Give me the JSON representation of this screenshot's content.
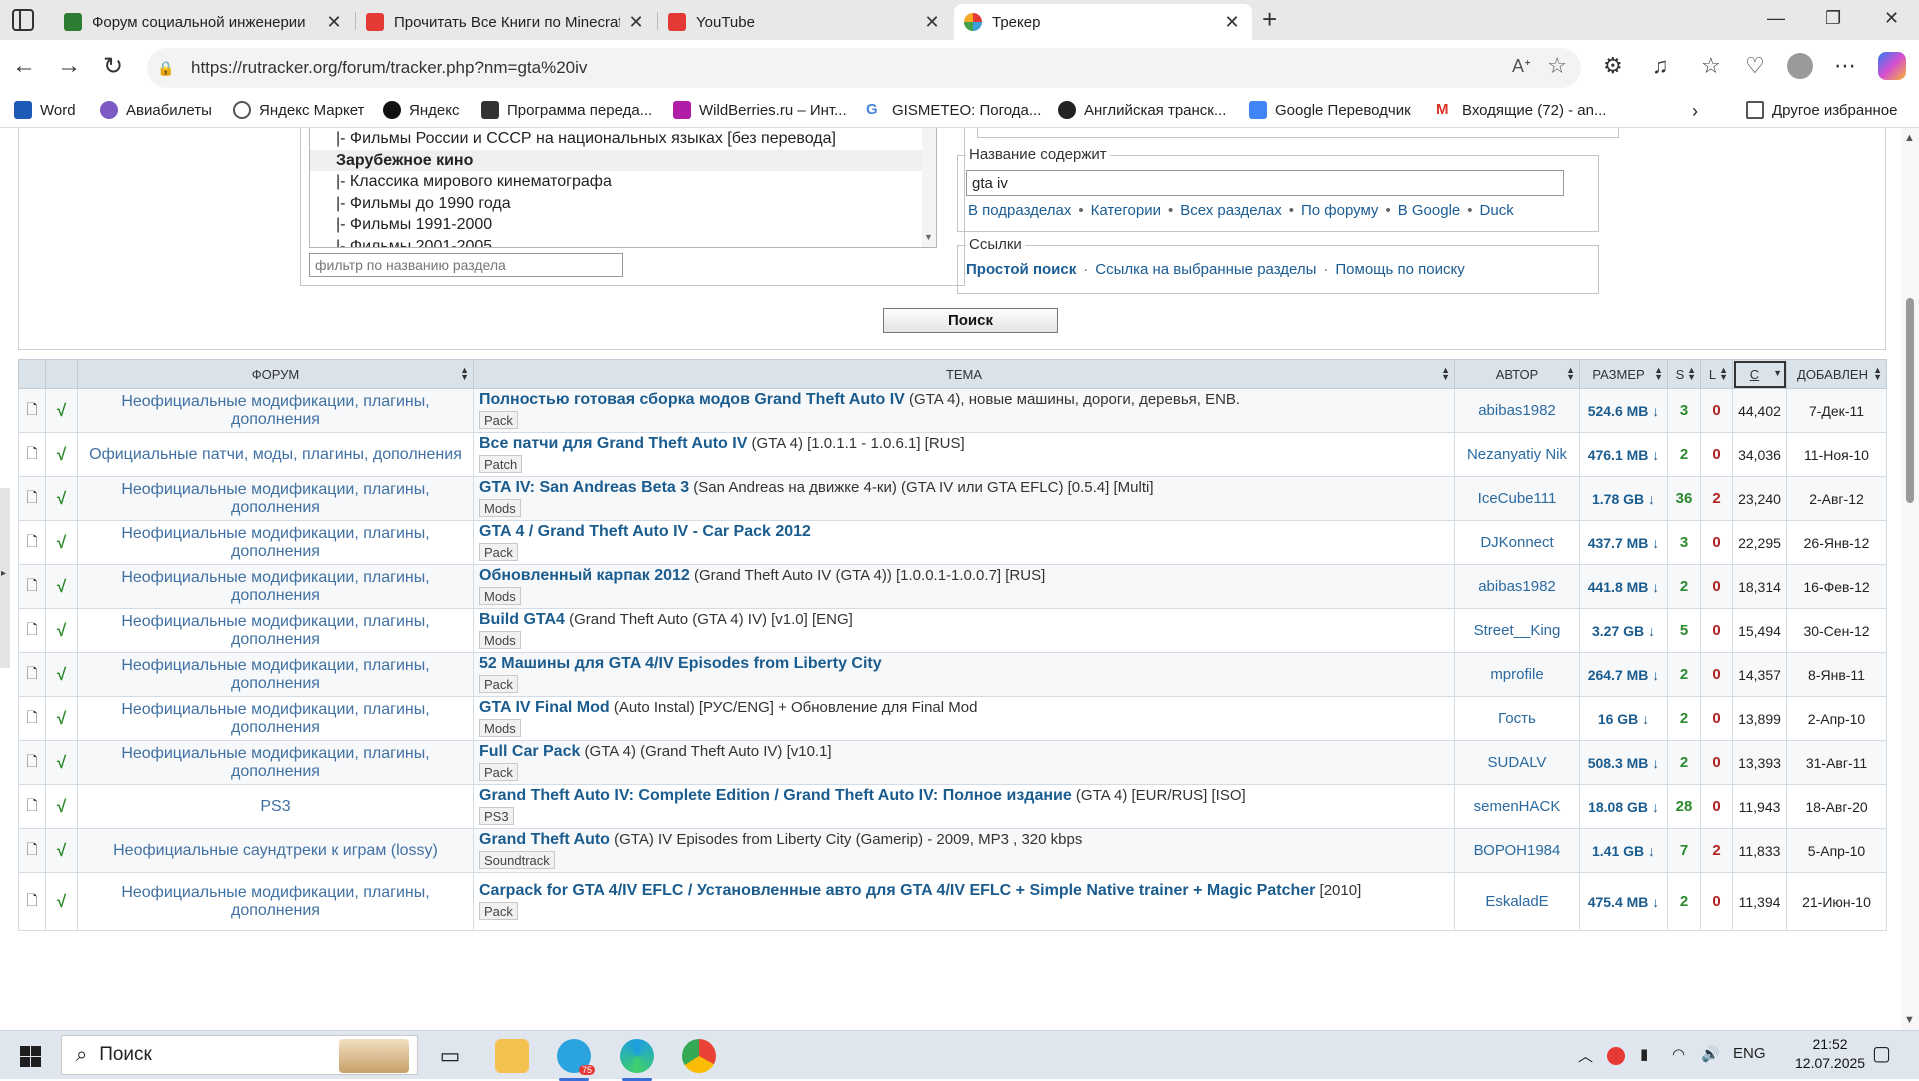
{
  "browser": {
    "tabs": [
      {
        "title": "Форум социальной инженерии",
        "favicon_color": "#2e7d32"
      },
      {
        "title": "Прочитать Все Книги по Minecraft",
        "favicon_color": "#e53935"
      },
      {
        "title": "YouTube",
        "favicon_color": "#e53935"
      },
      {
        "title": "Трекер",
        "favicon_color": "#3aa0d8"
      }
    ],
    "url": "https://rutracker.org/forum/tracker.php?nm=gta%20iv",
    "favorites": [
      {
        "label": "Word",
        "color": "#1e5bb8"
      },
      {
        "label": "Авиабилеты",
        "color": "#7c5cc4"
      },
      {
        "label": "Яндекс Маркет",
        "color": "#555555"
      },
      {
        "label": "Яндекс",
        "color": "#111111"
      },
      {
        "label": "Программа переда...",
        "color": "#333333"
      },
      {
        "label": "WildBerries.ru – Инт...",
        "color": "#b01ea8"
      },
      {
        "label": "GISMETEO: Погода...",
        "color": "#4a86d8"
      },
      {
        "label": "Английская транск...",
        "color": "#222222"
      },
      {
        "label": "Google Переводчик",
        "color": "#4285f4"
      },
      {
        "label": "Входящие (72) - an...",
        "color": "#d93025"
      },
      {
        "label": "Другое избранное",
        "color": "#555555"
      }
    ]
  },
  "search": {
    "forum_options": [
      {
        "label": "|- Фильмы России и СССР на национальных языках [без перевода]",
        "group": false
      },
      {
        "label": "Зарубежное кино",
        "group": true
      },
      {
        "label": "|- Классика мирового кинематографа",
        "group": false
      },
      {
        "label": "|- Фильмы до 1990 года",
        "group": false
      },
      {
        "label": "|- Фильмы 1991-2000",
        "group": false
      },
      {
        "label": "|- Фильмы 2001-2005",
        "group": false
      }
    ],
    "filter_placeholder": "фильтр по названию раздела",
    "name_legend": "Название содержит",
    "name_value": "gta iv",
    "name_links": [
      "В подразделах",
      "Категории",
      "Всех разделах",
      "По форуму",
      "В Google",
      "Duck"
    ],
    "links_legend": "Ссылки",
    "links": [
      "Простой поиск",
      "Ссылка на выбранные разделы",
      "Помощь по поиску"
    ],
    "submit_label": "Поиск"
  },
  "table": {
    "headers": {
      "forum": "ФОРУМ",
      "topic": "ТЕМА",
      "author": "АВТОР",
      "size": "РАЗМЕР",
      "seeds": "S",
      "leech": "L",
      "downloads": "C",
      "added": "ДОБАВЛЕН"
    },
    "rows": [
      {
        "forum": "Неофициальные модификации, плагины, дополнения",
        "title_bold": "Полностью готовая сборка модов Grand Theft Auto IV",
        "title_rest": " (GTA 4), новые машины, дороги, деревья, ENB.",
        "tag": "Pack",
        "author": "abibas1982",
        "size": "524.6 MB ↓",
        "seeds": "3",
        "leech": "0",
        "downloads": "44,402",
        "added": "7-Дек-11"
      },
      {
        "forum": "Официальные патчи, моды, плагины, дополнения",
        "title_bold": "Все патчи для Grand Theft Auto IV",
        "title_rest": " (GTA 4) [1.0.1.1 - 1.0.6.1] [RUS]",
        "tag": "Patch",
        "author": "Nezanyatiy Nik",
        "size": "476.1 MB ↓",
        "seeds": "2",
        "leech": "0",
        "downloads": "34,036",
        "added": "11-Ноя-10"
      },
      {
        "forum": "Неофициальные модификации, плагины, дополнения",
        "title_bold": "GTA IV: San Andreas Beta 3",
        "title_rest": " (San Andreas на движке 4-ки) (GTA IV или GTA EFLC) [0.5.4] [Multi]",
        "tag": "Mods",
        "author": "IceCube111",
        "size": "1.78 GB ↓",
        "seeds": "36",
        "leech": "2",
        "downloads": "23,240",
        "added": "2-Авг-12"
      },
      {
        "forum": "Неофициальные модификации, плагины, дополнения",
        "title_bold": "GTA 4 / Grand Theft Auto IV - Car Pack 2012",
        "title_rest": "",
        "tag": "Pack",
        "author": "DJKonnect",
        "size": "437.7 MB ↓",
        "seeds": "3",
        "leech": "0",
        "downloads": "22,295",
        "added": "26-Янв-12"
      },
      {
        "forum": "Неофициальные модификации, плагины, дополнения",
        "title_bold": "Обновленный карпак 2012",
        "title_rest": " (Grand Theft Auto IV (GTA 4)) [1.0.0.1-1.0.0.7] [RUS]",
        "tag": "Mods",
        "author": "abibas1982",
        "size": "441.8 MB ↓",
        "seeds": "2",
        "leech": "0",
        "downloads": "18,314",
        "added": "16-Фев-12"
      },
      {
        "forum": "Неофициальные модификации, плагины, дополнения",
        "title_bold": "Build GTA4",
        "title_rest": " (Grand Theft Auto (GTA 4) IV) [v1.0] [ENG]",
        "tag": "Mods",
        "author": "Street__King",
        "size": "3.27 GB ↓",
        "seeds": "5",
        "leech": "0",
        "downloads": "15,494",
        "added": "30-Сен-12"
      },
      {
        "forum": "Неофициальные модификации, плагины, дополнения",
        "title_bold": "52 Машины для GTA 4/IV Episodes from Liberty City",
        "title_rest": "",
        "tag": "Pack",
        "author": "mprofile",
        "size": "264.7 MB ↓",
        "seeds": "2",
        "leech": "0",
        "downloads": "14,357",
        "added": "8-Янв-11"
      },
      {
        "forum": "Неофициальные модификации, плагины, дополнения",
        "title_bold": "GTA IV Final Mod",
        "title_rest": " (Auto Instal) [РУС/ENG] + Обновление для Final Mod",
        "tag": "Mods",
        "author": "Гость",
        "size": "16 GB ↓",
        "seeds": "2",
        "leech": "0",
        "downloads": "13,899",
        "added": "2-Апр-10"
      },
      {
        "forum": "Неофициальные модификации, плагины, дополнения",
        "title_bold": "Full Car Pack",
        "title_rest": " (GTA 4) (Grand Theft Auto IV) [v10.1]",
        "tag": "Pack",
        "author": "SUDALV",
        "size": "508.3 MB ↓",
        "seeds": "2",
        "leech": "0",
        "downloads": "13,393",
        "added": "31-Авг-11"
      },
      {
        "forum": "PS3",
        "title_bold": "Grand Theft Auto IV: Complete Edition / Grand Theft Auto IV: Полное издание",
        "title_rest": " (GTA 4) [EUR/RUS] [ISO]",
        "tag": "PS3",
        "author": "semenHACK",
        "size": "18.08 GB ↓",
        "seeds": "28",
        "leech": "0",
        "downloads": "11,943",
        "added": "18-Авг-20"
      },
      {
        "forum": "Неофициальные саундтреки к играм (lossy)",
        "title_bold": "Grand Theft Auto",
        "title_rest": " (GTA) IV Episodes from Liberty City (Gamerip) - 2009, MP3 , 320 kbps",
        "tag": "Soundtrack",
        "author": "ВОРОН1984",
        "size": "1.41 GB ↓",
        "seeds": "7",
        "leech": "2",
        "downloads": "11,833",
        "added": "5-Апр-10"
      },
      {
        "forum": "Неофициальные модификации, плагины, дополнения",
        "title_bold": "Carpack for GTA 4/IV EFLC / Установленные авто для GTA 4/IV EFLC + Simple Native trainer + Magic Patcher",
        "title_rest": " [2010]",
        "tag": "Pack",
        "author": "EskaladE",
        "size": "475.4 MB ↓",
        "seeds": "2",
        "leech": "0",
        "downloads": "11,394",
        "added": "21-Июн-10"
      }
    ]
  },
  "taskbar": {
    "search_placeholder": "Поиск",
    "telegram_badge": "75",
    "lang": "ENG",
    "time": "21:52",
    "date": "12.07.2025"
  }
}
